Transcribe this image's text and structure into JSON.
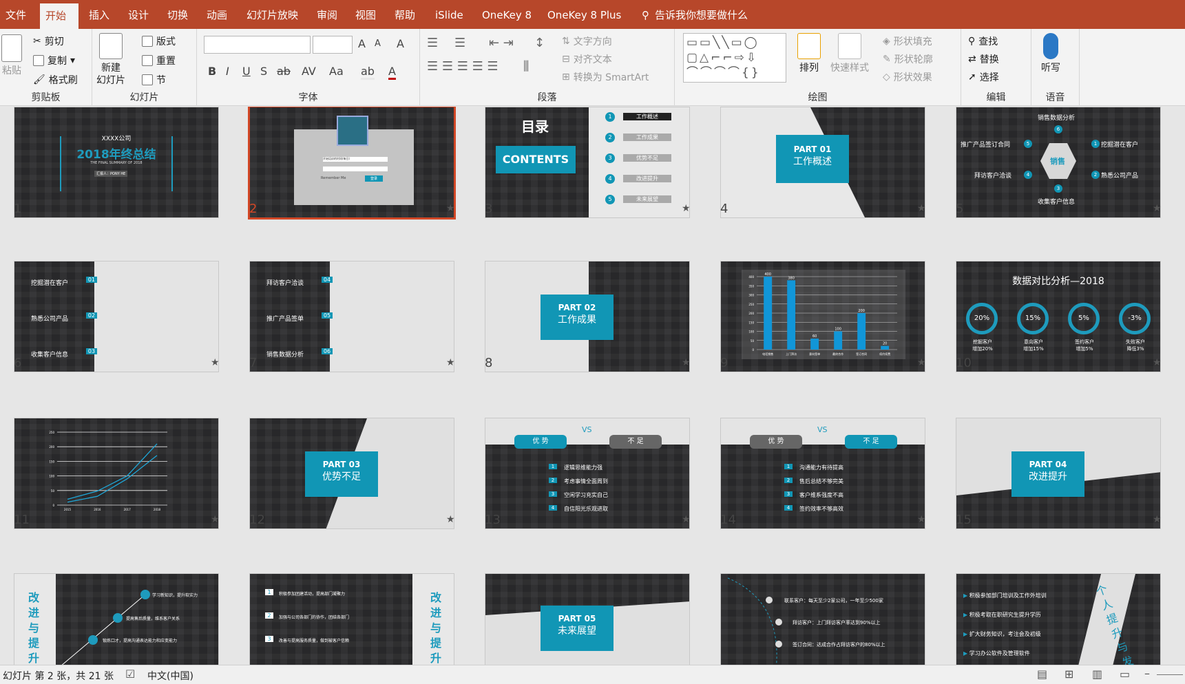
{
  "tabs": [
    "文件",
    "开始",
    "插入",
    "设计",
    "切换",
    "动画",
    "幻灯片放映",
    "审阅",
    "视图",
    "帮助",
    "iSlide",
    "OneKey 8",
    "OneKey 8 Plus"
  ],
  "active_tab": "开始",
  "tellme": "告诉我你想要做什么",
  "ribbon": {
    "clipboard": {
      "label": "剪贴板",
      "paste": "粘贴",
      "cut": "剪切",
      "copy": "复制",
      "painter": "格式刷"
    },
    "slides": {
      "label": "幻灯片",
      "new_slide": "新建",
      "new_slide2": "幻灯片",
      "layout": "版式",
      "reset": "重置",
      "section": "节"
    },
    "font": {
      "label": "字体",
      "font_name": "",
      "font_size": "",
      "bold": "B",
      "italic": "I",
      "underline": "U",
      "shadow": "S",
      "strike": "ab",
      "spacing": "AV",
      "case": "Aa",
      "grow": "A",
      "shrink": "A",
      "clear": "A",
      "color": "A",
      "highlight": "ab"
    },
    "paragraph": {
      "label": "段落",
      "text_dir": "文字方向",
      "align_text": "对齐文本",
      "smartart": "转换为 SmartArt"
    },
    "drawing": {
      "label": "绘图",
      "arrange": "排列",
      "quick_styles": "快速样式",
      "fill": "形状填充",
      "outline": "形状轮廓",
      "effects": "形状效果"
    },
    "editing": {
      "label": "编辑",
      "find": "查找",
      "replace": "替换",
      "select": "选择"
    },
    "voice": {
      "label": "语音",
      "dictate": "听写"
    }
  },
  "slides": [
    {
      "n": "1",
      "company": "XXXX公司",
      "title": "2018年终总结",
      "sub": "THE FINAL SUMMARY OF 2018",
      "reporter": "汇报人：PONY HE"
    },
    {
      "n": "2",
      "field1": "开始培训的时间(每日)",
      "remember": "Remember Me",
      "login": "登录"
    },
    {
      "n": "3",
      "title": "目录",
      "contents": "CONTENTS",
      "items": [
        "工作概述",
        "工作成果",
        "优势不足",
        "改进提升",
        "未来展望"
      ],
      "nums": [
        "1",
        "2",
        "3",
        "4",
        "5"
      ]
    },
    {
      "n": "4",
      "part": "PART 01",
      "title": "工作概述"
    },
    {
      "n": "5",
      "center": "销售",
      "items": [
        "销售数据分析",
        "挖掘潜在客户",
        "熟悉公司产品",
        "收集客户信息",
        "拜访客户洽谈",
        "推广产品签订合同"
      ],
      "nums": [
        "6",
        "1",
        "2",
        "3",
        "4",
        "5"
      ]
    },
    {
      "n": "6",
      "rows": [
        "挖掘潜在客户",
        "熟悉公司产品",
        "收集客户信息"
      ],
      "nums": [
        "01",
        "02",
        "03"
      ]
    },
    {
      "n": "7",
      "rows": [
        "拜访客户洽谈",
        "推广产品签单",
        "销售数据分析"
      ],
      "nums": [
        "04",
        "05",
        "06"
      ]
    },
    {
      "n": "8",
      "part": "PART 02",
      "title": "工作成果"
    },
    {
      "n": "9"
    },
    {
      "n": "10",
      "title": "数据对比分析—2018",
      "rings": [
        "20%",
        "15%",
        "5%",
        "-3%"
      ],
      "labels": [
        "挖掘客户\n增加20%",
        "意向客户\n增加15%",
        "签约客户\n增加5%",
        "失败客户\n降低3%"
      ]
    },
    {
      "n": "11"
    },
    {
      "n": "12",
      "part": "PART 03",
      "title": "优势不足"
    },
    {
      "n": "13",
      "vs": "VS",
      "left": "优 势",
      "right": "不 足",
      "items": [
        "逻辑思维能力强",
        "考虑事情全面周到",
        "空闲学习充实自己",
        "自信阳光乐观进取"
      ],
      "nums": [
        "1",
        "2",
        "3",
        "4"
      ]
    },
    {
      "n": "14",
      "vs": "VS",
      "left": "优 势",
      "right": "不 足",
      "items": [
        "沟通能力有待提高",
        "售后总结不够完美",
        "客户维系强度不高",
        "签约效率不够高效"
      ],
      "nums": [
        "1",
        "2",
        "3",
        "4"
      ]
    },
    {
      "n": "15",
      "part": "PART 04",
      "title": "改进提升"
    },
    {
      "n": "16",
      "side": "改进与提升",
      "items": [
        "学习新知识，提升软实力",
        "提高售后质量，维系客户关系",
        "锻炼口才，提高沟通表达能力和应变能力"
      ]
    },
    {
      "n": "17",
      "side": "改进与提升",
      "items": [
        "积极参加团建活动，提高部门凝聚力",
        "加强与公司各部门的协作，团结各部门",
        "改善与提高服务质量，做到被客户信赖"
      ],
      "nums": [
        "1",
        "2",
        "3"
      ]
    },
    {
      "n": "18",
      "part": "PART 05",
      "title": "未来展望"
    },
    {
      "n": "19",
      "items": [
        "联系客户：每天至少2家公司，一年至少500家",
        "拜访客户：上门拜访客户率达到90%以上",
        "签订合同：达成合作占拜访客户的80%以上"
      ]
    },
    {
      "n": "20",
      "side": "个人提升与发",
      "items": [
        "积极参加部门培训及工作外培训",
        "积极考取在职研究生提升学历",
        "扩大财务知识，考注会及初级",
        "学习办公软件及管理软件"
      ]
    }
  ],
  "chart_data": [
    {
      "type": "bar",
      "categories": [
        "电话销售",
        "上门拜访",
        "意向签单",
        "最终合作",
        "签订合同",
        "续约续费"
      ],
      "values": [
        400,
        380,
        60,
        100,
        200,
        20
      ],
      "ylim": [
        0,
        400
      ]
    },
    {
      "type": "line",
      "x": [
        "2015",
        "2016",
        "2017",
        "2018"
      ],
      "series": [
        {
          "values": [
            20,
            48,
            100,
            210
          ]
        },
        {
          "values": [
            10,
            30,
            90,
            170
          ]
        }
      ],
      "ylim": [
        0,
        250
      ]
    }
  ],
  "status": {
    "slide_info": "幻灯片 第 2 张，共 21 张",
    "language": "中文(中国)"
  },
  "colors": {
    "teal": "#1196b5",
    "brand": "#b7472a"
  }
}
